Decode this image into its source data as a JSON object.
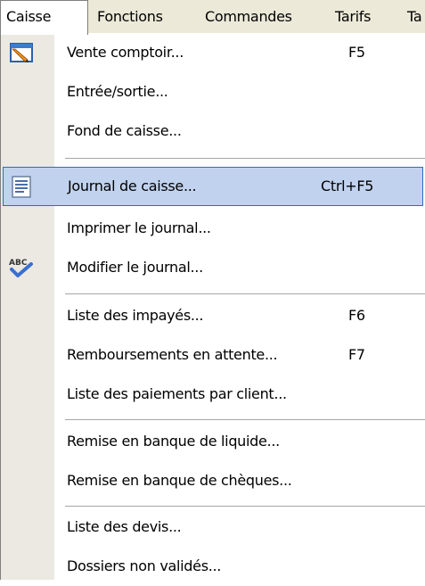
{
  "menubar": {
    "items": [
      {
        "label": "Caisse",
        "active": true
      },
      {
        "label": "Fonctions"
      },
      {
        "label": "Commandes"
      },
      {
        "label": "Tarifs"
      },
      {
        "label": "Ta"
      }
    ]
  },
  "menu": {
    "items": [
      {
        "label": "Vente comptoir...",
        "shortcut": "F5",
        "icon": "pencil-window-icon"
      },
      {
        "label": "Entrée/sortie..."
      },
      {
        "label": "Fond de caisse..."
      },
      {
        "label": "Journal de caisse...",
        "shortcut": "Ctrl+F5",
        "icon": "document-list-icon",
        "highlighted": true
      },
      {
        "label": "Imprimer le journal..."
      },
      {
        "label": "Modifier le journal...",
        "icon": "spellcheck-abc-icon"
      },
      {
        "label": "Liste des impayés...",
        "shortcut": "F6"
      },
      {
        "label": "Remboursements en attente...",
        "shortcut": "F7"
      },
      {
        "label": "Liste des paiements par client..."
      },
      {
        "label": "Remise en banque de liquide..."
      },
      {
        "label": "Remise en banque de chèques..."
      },
      {
        "label": "Liste des devis..."
      },
      {
        "label": "Dossiers non validés..."
      }
    ]
  },
  "colors": {
    "menubar_bg": "#ece9d8",
    "gutter_bg": "#ebe9e2",
    "highlight_bg": "#c1d2ee",
    "highlight_border": "#316ac5"
  }
}
